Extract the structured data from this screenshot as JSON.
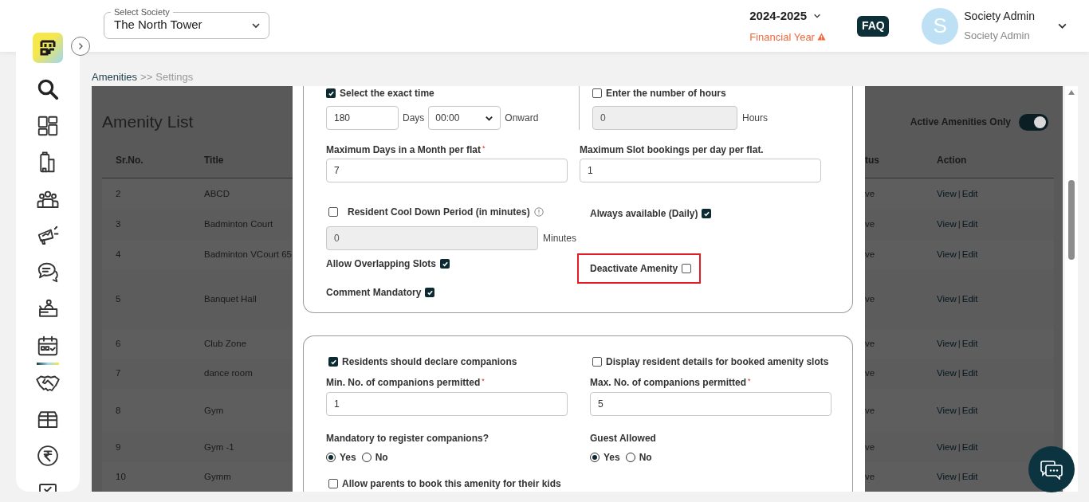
{
  "sidebar": {
    "items": [
      {
        "kind": "search",
        "selected": false
      },
      {
        "kind": "dashboard",
        "selected": false
      },
      {
        "kind": "building",
        "selected": false
      },
      {
        "kind": "residents",
        "selected": false
      },
      {
        "kind": "megaphone",
        "selected": false
      },
      {
        "kind": "chat",
        "selected": false
      },
      {
        "kind": "helpdesk",
        "selected": false
      },
      {
        "kind": "calendar",
        "selected": true
      },
      {
        "kind": "handshake",
        "selected": false
      },
      {
        "kind": "package",
        "selected": false
      },
      {
        "kind": "rupee",
        "selected": false
      },
      {
        "kind": "report",
        "selected": false
      }
    ]
  },
  "header": {
    "society_select": {
      "label": "Select Society",
      "value": "The North Tower"
    },
    "financial_year": {
      "value": "2024-2025",
      "label": "Financial Year"
    },
    "faq": "FAQ",
    "user": {
      "initial": "S",
      "name": "Society Admin",
      "role": "Society Admin"
    }
  },
  "breadcrumb": {
    "items": [
      "Amenities",
      "Settings"
    ],
    "separator": ">>"
  },
  "amenity_list": {
    "title": "Amenity List",
    "toggle": {
      "label": "Active Amenities Only",
      "on": true
    },
    "columns": [
      "Sr.No.",
      "Title",
      "tus",
      "Action"
    ],
    "action_separator": "|",
    "rows": [
      {
        "cells": [
          "2",
          "ABCD",
          "ve"
        ],
        "view": "View",
        "edit": "Edit"
      },
      {
        "cells": [
          "3",
          "Badminton Court",
          "ve"
        ],
        "view": "View",
        "edit": "Edit"
      },
      {
        "cells": [
          "4",
          "Badminton VCourt 65",
          "ve"
        ],
        "view": "View",
        "edit": "Edit"
      },
      {
        "cells": [
          "5",
          "Banquet Hall",
          "ve"
        ],
        "view": "View",
        "edit": "Edit"
      },
      {
        "cells": [
          "6",
          "Club Zone",
          "ve"
        ],
        "view": "View",
        "edit": "Edit"
      },
      {
        "cells": [
          "7",
          "dance room",
          "ve"
        ],
        "view": "View",
        "edit": "Edit"
      },
      {
        "cells": [
          "8",
          "Gym",
          "ve"
        ],
        "view": "View",
        "edit": "Edit"
      },
      {
        "cells": [
          "9",
          "Gym -1",
          "ve"
        ],
        "view": "View",
        "edit": "Edit"
      },
      {
        "cells": [
          "10",
          "Gymm",
          "ve"
        ],
        "view": "View",
        "edit": "Edit"
      }
    ]
  },
  "settings": {
    "exact_time": {
      "label": "Select the exact time",
      "checked": true,
      "days": {
        "value": "180",
        "disabled": false
      },
      "days_unit": "Days",
      "time": "00:00",
      "suffix": "Onward"
    },
    "hours": {
      "label": "Enter the number of hours",
      "checked": false,
      "input": {
        "value": "0",
        "disabled": true
      },
      "unit": "Hours"
    },
    "max_days": {
      "label": "Maximum Days in a Month per flat",
      "required_mark": "*",
      "input": {
        "value": "7",
        "disabled": false
      }
    },
    "max_slots": {
      "label": "Maximum Slot bookings per day per flat.",
      "input": {
        "value": "1",
        "disabled": false
      }
    },
    "cool_down": {
      "label": "Resident Cool Down Period (in minutes)",
      "checked": false,
      "input": {
        "value": "0",
        "disabled": true
      },
      "unit": "Minutes"
    },
    "always_available": {
      "label": "Always available (Daily)",
      "checked": true
    },
    "allow_overlapping": {
      "label": "Allow Overlapping Slots",
      "checked": true
    },
    "deactivate": {
      "label": "Deactivate Amenity",
      "checked": false,
      "highlighted": true
    },
    "comment_mandatory": {
      "label": "Comment Mandatory",
      "checked": true
    },
    "declare_companions": {
      "label": "Residents should declare companions",
      "checked": true
    },
    "display_details": {
      "label": "Display resident details for booked amenity slots",
      "checked": false
    },
    "min_companions": {
      "label": "Min. No. of companions permitted",
      "required_mark": "*",
      "input": {
        "value": "1",
        "disabled": false
      }
    },
    "max_companions": {
      "label": "Max. No. of companions permitted",
      "required_mark": "*",
      "input": {
        "value": "5",
        "disabled": false
      }
    },
    "mandatory_register": {
      "label": "Mandatory to register companions?",
      "options": [
        {
          "label": "Yes",
          "selected": true
        },
        {
          "label": "No",
          "selected": false
        }
      ]
    },
    "guest_allowed": {
      "label": "Guest Allowed",
      "options": [
        {
          "label": "Yes",
          "selected": true
        },
        {
          "label": "No",
          "selected": false
        }
      ]
    },
    "allow_parents": {
      "label": "Allow parents to book this amenity for their kids",
      "checked": false
    }
  }
}
